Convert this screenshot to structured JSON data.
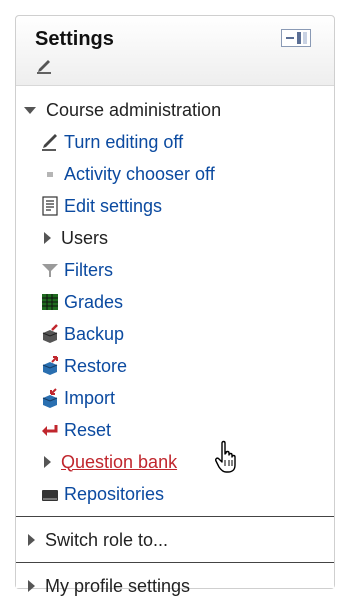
{
  "block": {
    "title": "Settings"
  },
  "course_admin": {
    "label": "Course administration",
    "items": [
      {
        "label": "Turn editing off",
        "icon": "pencil-icon"
      },
      {
        "label": "Activity chooser off",
        "icon": "bullet-icon"
      },
      {
        "label": "Edit settings",
        "icon": "document-icon"
      },
      {
        "label": "Users",
        "icon": "expand-arrow-icon"
      },
      {
        "label": "Filters",
        "icon": "filter-funnel-icon"
      },
      {
        "label": "Grades",
        "icon": "grades-grid-icon"
      },
      {
        "label": "Backup",
        "icon": "backup-box-icon"
      },
      {
        "label": "Restore",
        "icon": "restore-box-icon"
      },
      {
        "label": "Import",
        "icon": "import-box-icon"
      },
      {
        "label": "Reset",
        "icon": "reset-arrow-icon"
      },
      {
        "label": "Question bank",
        "icon": "expand-arrow-icon"
      },
      {
        "label": "Repositories",
        "icon": "repository-drive-icon"
      }
    ]
  },
  "switch_role": {
    "label": "Switch role to..."
  },
  "profile_settings": {
    "label": "My profile settings"
  },
  "colors": {
    "link": "#0b4aa0",
    "hovered_link": "#c0262d"
  }
}
